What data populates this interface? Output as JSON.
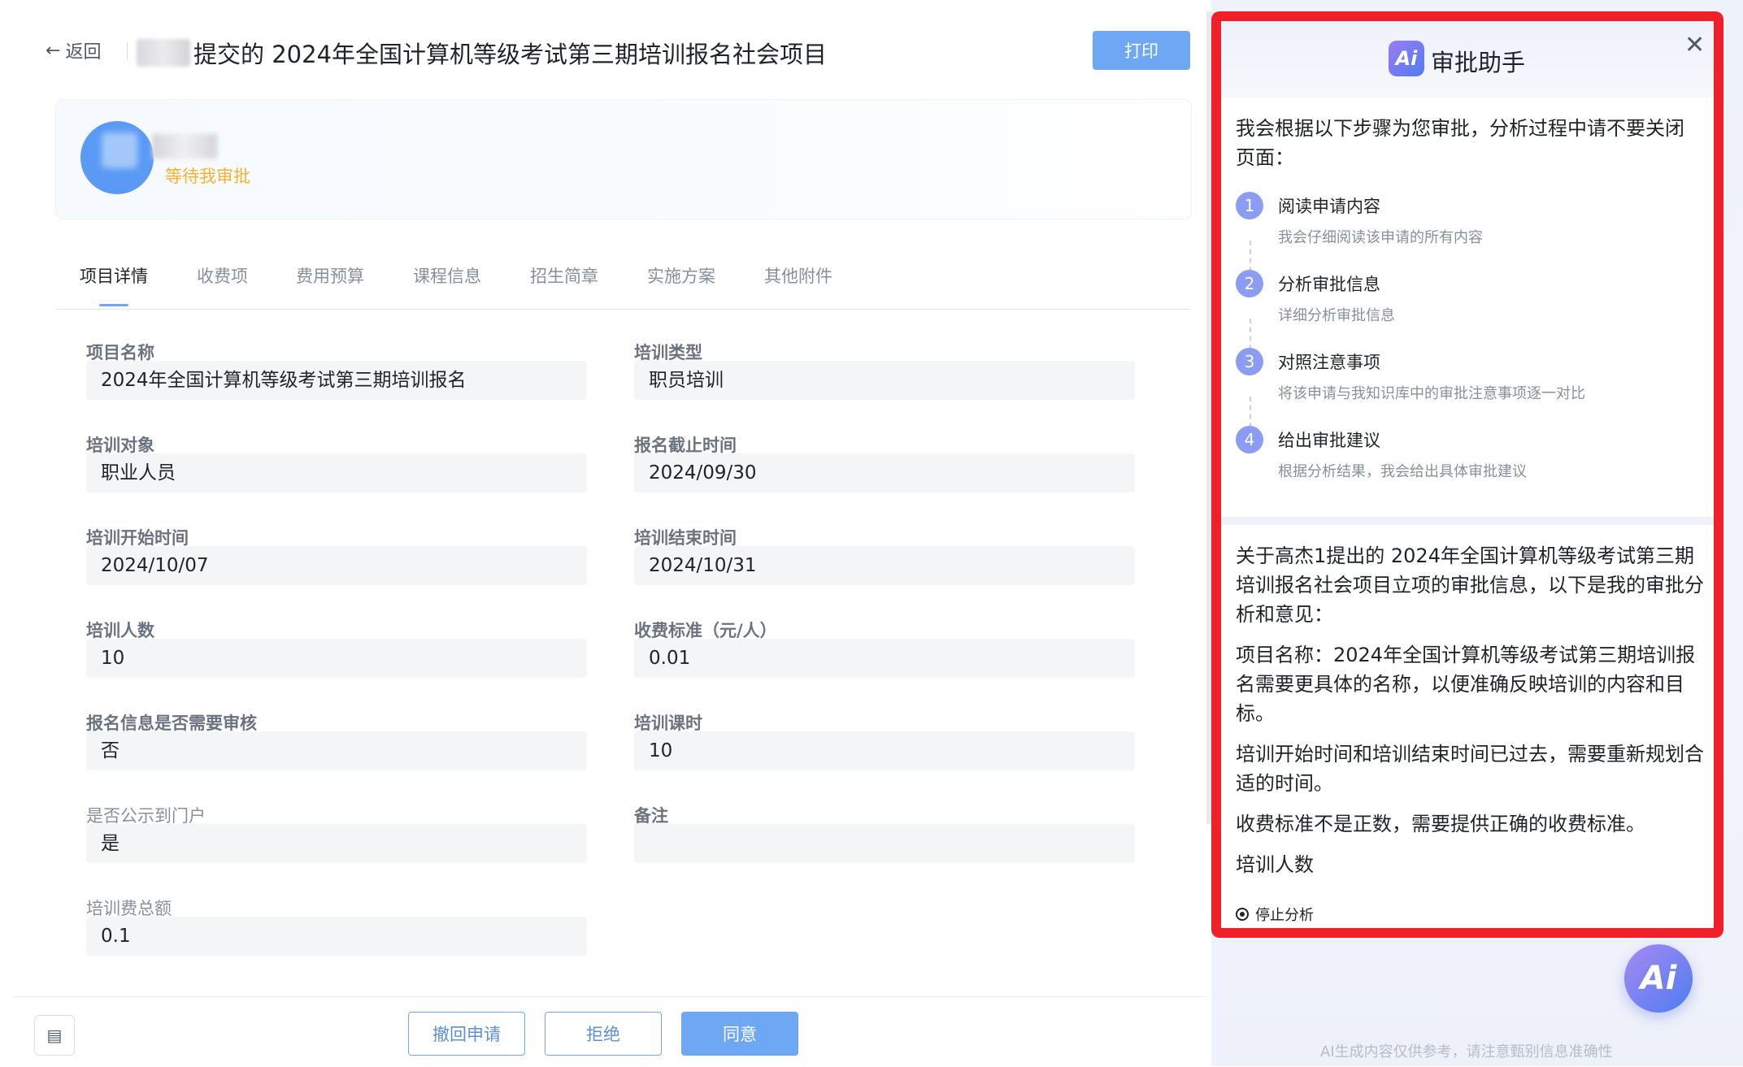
{
  "header": {
    "back_label": "返回",
    "title": "提交的 2024年全国计算机等级考试第三期培训报名社会项目",
    "print_label": "打印"
  },
  "applicant": {
    "status": "等待我审批"
  },
  "tabs": [
    {
      "label": "项目详情"
    },
    {
      "label": "收费项"
    },
    {
      "label": "费用预算"
    },
    {
      "label": "课程信息"
    },
    {
      "label": "招生简章"
    },
    {
      "label": "实施方案"
    },
    {
      "label": "其他附件"
    }
  ],
  "fields": {
    "project_name": {
      "label": "项目名称",
      "value": "2024年全国计算机等级考试第三期培训报名"
    },
    "training_type": {
      "label": "培训类型",
      "value": "职员培训"
    },
    "training_target": {
      "label": "培训对象",
      "value": "职业人员"
    },
    "signup_deadline": {
      "label": "报名截止时间",
      "value": "2024/09/30"
    },
    "start_time": {
      "label": "培训开始时间",
      "value": "2024/10/07"
    },
    "end_time": {
      "label": "培训结束时间",
      "value": "2024/10/31"
    },
    "headcount": {
      "label": "培训人数",
      "value": "10"
    },
    "fee_standard": {
      "label": "收费标准（元/人）",
      "value": "0.01"
    },
    "need_review": {
      "label": "报名信息是否需要审核",
      "value": "否"
    },
    "class_hours": {
      "label": "培训课时",
      "value": "10"
    },
    "publish_portal": {
      "label": "是否公示到门户",
      "value": "是"
    },
    "remark": {
      "label": "备注",
      "value": ""
    },
    "total_fee": {
      "label": "培训费总额",
      "value": "0.1"
    }
  },
  "footer": {
    "withdraw_label": "撤回申请",
    "reject_label": "拒绝",
    "approve_label": "同意"
  },
  "ai_panel": {
    "logo_text": "Ai",
    "title": "审批助手",
    "intro": "我会根据以下步骤为您审批，分析过程中请不要关闭页面：",
    "steps": [
      {
        "num": "1",
        "title": "阅读申请内容",
        "desc": "我会仔细阅读该申请的所有内容"
      },
      {
        "num": "2",
        "title": "分析审批信息",
        "desc": "详细分析审批信息"
      },
      {
        "num": "3",
        "title": "对照注意事项",
        "desc": "将该申请与我知识库中的审批注意事项逐一对比"
      },
      {
        "num": "4",
        "title": "给出审批建议",
        "desc": "根据分析结果，我会给出具体审批建议"
      }
    ],
    "analysis": [
      "关于高杰1提出的 2024年全国计算机等级考试第三期培训报名社会项目立项的审批信息，以下是我的审批分析和意见：",
      "项目名称：2024年全国计算机等级考试第三期培训报名需要更具体的名称，以便准确反映培训的内容和目标。",
      "培训开始时间和培训结束时间已过去，需要重新规划合适的时间。",
      "收费标准不是正数，需要提供正确的收费标准。",
      "培训人数"
    ],
    "stop_label": "停止分析",
    "fab_text": "Ai",
    "disclaimer": "AI生成内容仅供参考，请注意甄别信息准确性"
  },
  "colors": {
    "primary": "#6ea7f3",
    "highlight_border": "#f0202a",
    "status_pending": "#f5b22f"
  },
  "icons": {
    "back": "arrow-left-icon",
    "close": "close-icon",
    "comment": "comment-icon",
    "stop": "stop-circle-icon"
  }
}
